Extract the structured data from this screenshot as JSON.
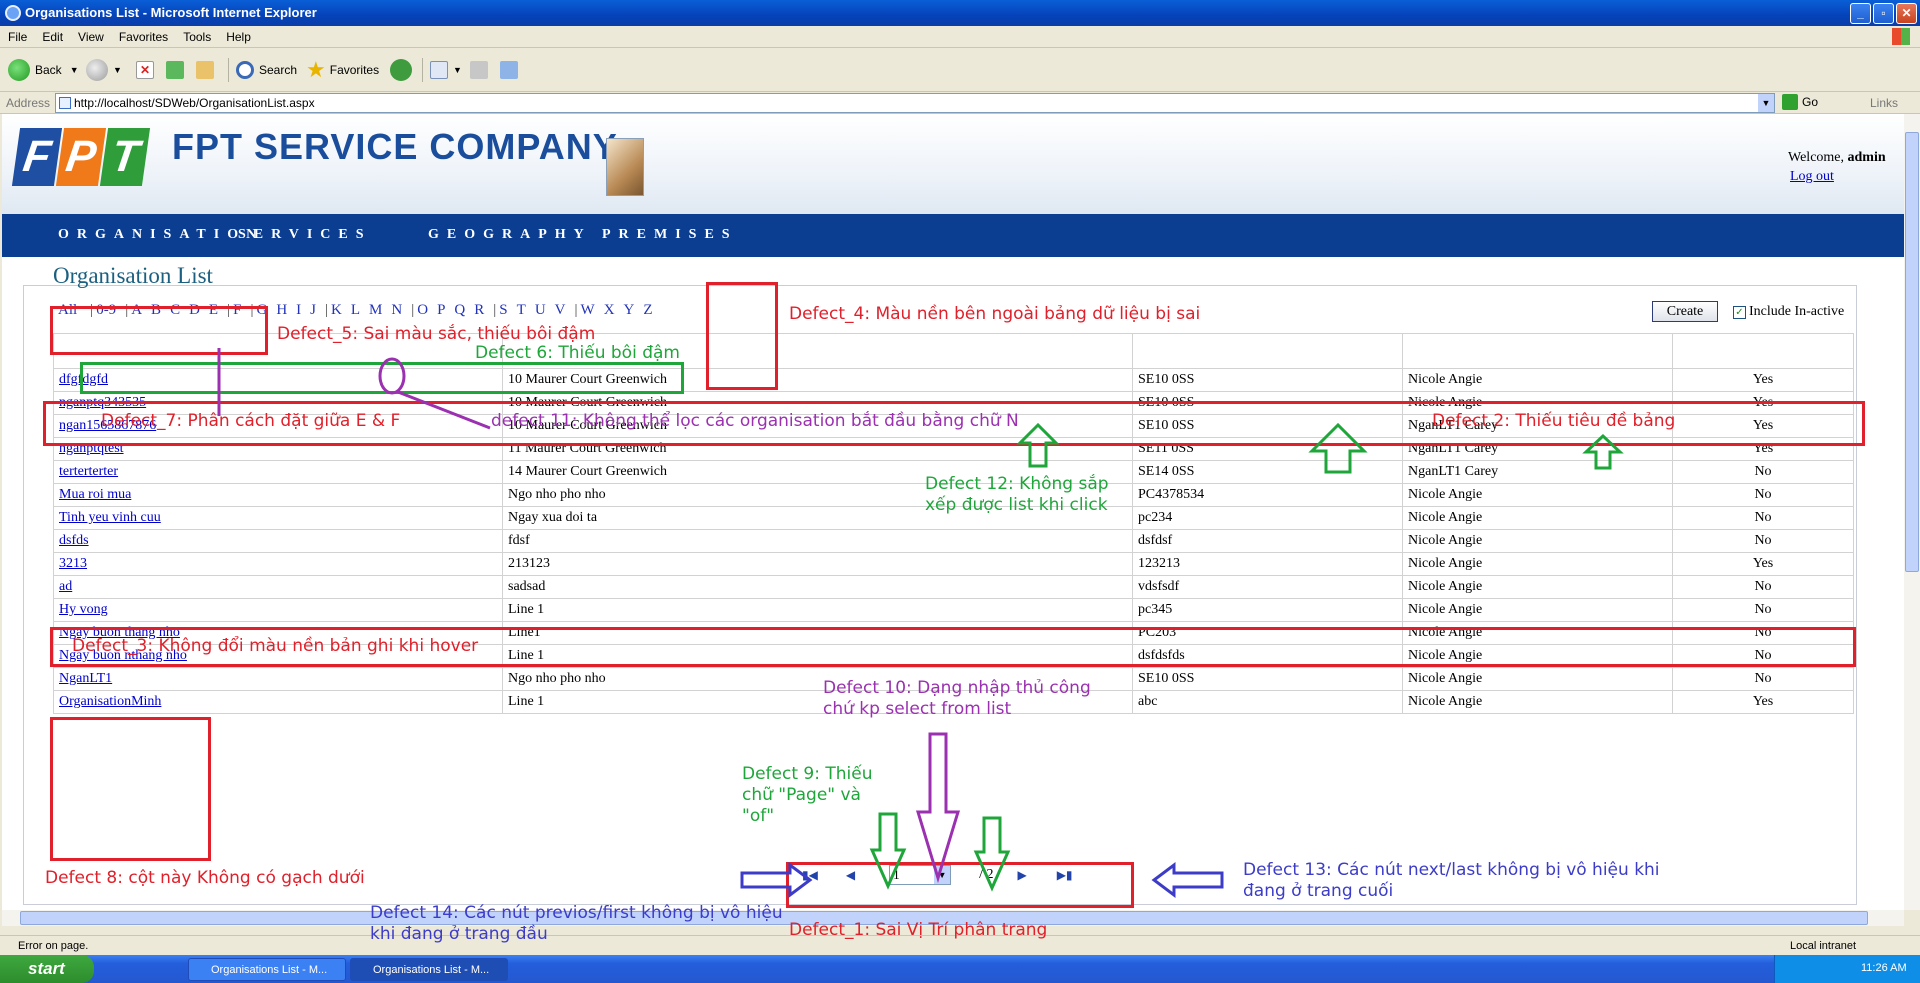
{
  "window": {
    "title": "Organisations List - Microsoft Internet Explorer"
  },
  "menu": [
    "File",
    "Edit",
    "View",
    "Favorites",
    "Tools",
    "Help"
  ],
  "toolbar": {
    "back": "Back",
    "search": "Search",
    "favorites": "Favorites"
  },
  "address": {
    "label": "Address",
    "url": "http://localhost/SDWeb/OrganisationList.aspx",
    "go": "Go",
    "links": "Links"
  },
  "header": {
    "logo_letters": [
      "F",
      "P",
      "T"
    ],
    "company": "FPT SERVICE COMPANY",
    "welcome": "Welcome,",
    "user": "admin",
    "logout": "Log out"
  },
  "nav": [
    "ORGANISATION",
    "SERVICES",
    "GEOGRAPHY",
    "PREMISES"
  ],
  "page": {
    "title": "Organisation List",
    "create": "Create",
    "include_inactive": "Include In-active"
  },
  "alpha": {
    "all": "All",
    "groups": [
      [
        "0-9"
      ],
      [
        "A",
        "B",
        "C",
        "D",
        "E",
        "F"
      ],
      [
        "G",
        "H",
        "I",
        "J"
      ],
      [
        "K",
        "L",
        "M",
        "N"
      ],
      [
        "O",
        "P",
        "Q",
        "R"
      ],
      [
        "S",
        "T",
        "U",
        "V"
      ],
      [
        "W",
        "X",
        "Y",
        "Z"
      ]
    ]
  },
  "rows": [
    [
      "dfgfdgfd",
      "10 Maurer Court Greenwich",
      "SE10 0SS",
      "Nicole Angie",
      "Yes"
    ],
    [
      "nganptq343535",
      "10 Maurer Court Greenwich",
      "SE10 0SS",
      "Nicole Angie",
      "Yes"
    ],
    [
      "ngan1565867876",
      "10 Maurer Court Greenwich",
      "SE10 0SS",
      "NganLT1 Carey",
      "Yes"
    ],
    [
      "nganptqtest",
      "11 Maurer Court Greenwich",
      "SE11 0SS",
      "NganLT1 Carey",
      "Yes"
    ],
    [
      "terterterter",
      "14 Maurer Court Greenwich",
      "SE14 0SS",
      "NganLT1 Carey",
      "No"
    ],
    [
      "Mua roi mua",
      "Ngo nho pho nho",
      "PC4378534",
      "Nicole Angie",
      "No"
    ],
    [
      "Tinh yeu vinh cuu",
      "Ngay xua doi ta",
      "pc234",
      "Nicole Angie",
      "No"
    ],
    [
      "dsfds",
      "fdsf",
      "dsfdsf",
      "Nicole Angie",
      "No"
    ],
    [
      "3213",
      "213123",
      "123213",
      "Nicole Angie",
      "Yes"
    ],
    [
      "ad",
      "sadsad",
      "vdsfsdf",
      "Nicole Angie",
      "No"
    ],
    [
      "Hy vong",
      "Line 1",
      "pc345",
      "Nicole Angie",
      "No"
    ],
    [
      "Ngay buon thang nho",
      "Line1",
      "PC203",
      "Nicole Angie",
      "No"
    ],
    [
      "Ngay buon nthang nho",
      "Line 1",
      "dsfdsfds",
      "Nicole Angie",
      "No"
    ],
    [
      "NganLT1",
      "Ngo nho pho nho",
      "SE10 0SS",
      "Nicole Angie",
      "No"
    ],
    [
      "OrganisationMinh",
      "Line 1",
      "abc",
      "Nicole Angie",
      "Yes"
    ]
  ],
  "pager": {
    "current": "1",
    "total": "/ 2"
  },
  "status": {
    "text": "Error on page.",
    "zone": "Local intranet"
  },
  "taskbar": {
    "start": "start",
    "tasks": [
      "Organisations List - M...",
      "Organisations List - M..."
    ],
    "time": "11:26 AM"
  },
  "annotations": {
    "d1": "Defect_1: Sai Vị Trí phân trang",
    "d2": "Defect 2: Thiếu tiêu đề bảng",
    "d3": "Defect_3: Không đổi màu nền bản ghi khi hover",
    "d4": "Defect_4: Màu nền bên ngoài bảng dữ liệu bị sai",
    "d5": "Defect_5: Sai màu sắc, thiếu bôi đậm",
    "d6": "Defect 6: Thiếu bôi đậm",
    "d7": "Defect_7: Phân cách đặt giữa E & F",
    "d8": "Defect 8: cột này Không có gạch dưới",
    "d9": [
      "Defect 9: Thiếu",
      "chữ \"Page\" và",
      "\"of\""
    ],
    "d10": [
      "Defect 10: Dạng nhập thủ công",
      "chứ kp select from list"
    ],
    "d11": "defect 11: Không thể lọc các organisation bắt đầu bằng chữ N",
    "d12": [
      "Defect 12: Không sắp",
      "xếp được list khi click"
    ],
    "d13": [
      "Defect 13: Các nút next/last không bị vô hiệu khi",
      "đang ở trang cuối"
    ],
    "d14": [
      "Defect 14: Các nút previos/first không bị vô hiệu",
      "khi đang ở trang đầu"
    ]
  }
}
